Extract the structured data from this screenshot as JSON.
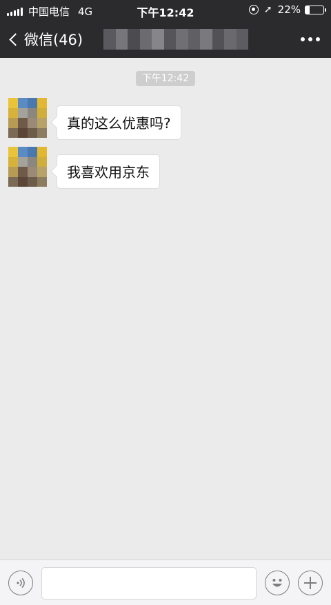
{
  "status_bar": {
    "carrier": "中国电信",
    "network": "4G",
    "time": "下午12:42",
    "battery": "22%",
    "battery_level": 0.22,
    "icons": [
      "signal-icon",
      "orientation-lock-icon",
      "location-arrow-icon",
      "battery-icon"
    ]
  },
  "nav": {
    "back_label": "微信(46)",
    "title_blurred": true
  },
  "chat": {
    "timestamp": "下午12:42",
    "messages": [
      {
        "sender": "other",
        "text": "真的这么优惠吗?"
      },
      {
        "sender": "other",
        "text": "我喜欢用京东"
      }
    ]
  },
  "input_bar": {
    "icons": [
      "voice-icon",
      "emoji-icon",
      "plus-icon"
    ],
    "placeholder": ""
  },
  "colors": {
    "header_bg": "#2b2b2e",
    "chat_bg": "#ebebeb",
    "bubble_bg": "#ffffff",
    "time_pill_bg": "#cecece",
    "input_bar_bg": "#f4f4f6"
  }
}
